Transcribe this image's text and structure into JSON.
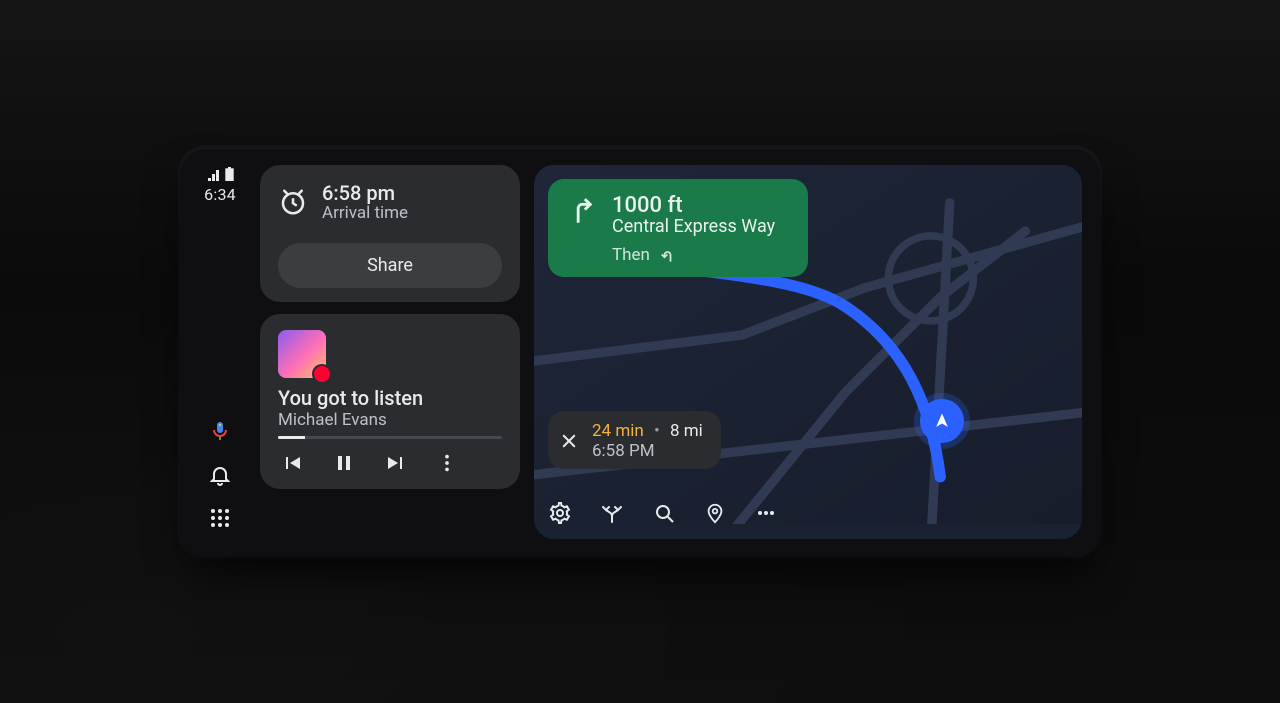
{
  "status": {
    "clock": "6:34"
  },
  "eta_card": {
    "time": "6:58 pm",
    "label": "Arrival time",
    "share": "Share"
  },
  "music": {
    "title": "You got to listen",
    "artist": "Michael Evans",
    "progress_pct": 12
  },
  "turn": {
    "distance": "1000 ft",
    "road": "Central Express Way",
    "then": "Then"
  },
  "trip": {
    "remaining_time": "24 min",
    "remaining_distance": "8 mi",
    "arrival": "6:58 PM"
  },
  "colors": {
    "turn_bg": "#1b7a4a",
    "route": "#2b62ff",
    "accent_time": "#f3b13b"
  }
}
